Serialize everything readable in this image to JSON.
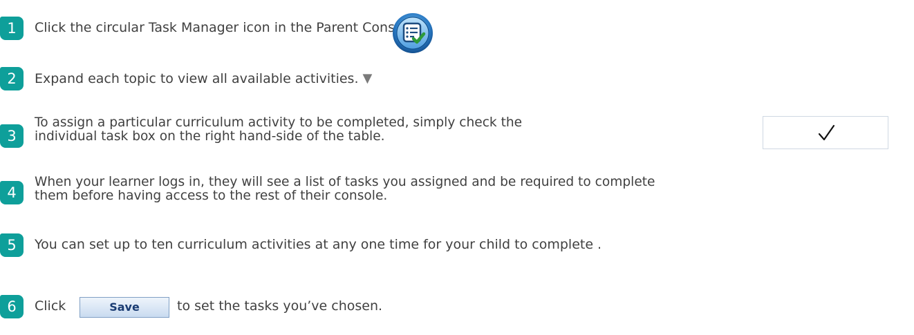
{
  "colors": {
    "badge": "#0e9f9a",
    "text": "#404040",
    "arrow": "#7a7a7a"
  },
  "steps": [
    {
      "number": "1",
      "text": "Click the circular Task Manager icon in the Parent Console."
    },
    {
      "number": "2",
      "text": "Expand each topic to view all available activities.",
      "arrow": "▼"
    },
    {
      "number": "3",
      "lines": [
        "To assign a particular curriculum activity to be completed, simply check the",
        "individual task box on the right hand-side of the table."
      ],
      "checkmark": "✓"
    },
    {
      "number": "4",
      "lines": [
        "When your learner logs in, they will see a list of tasks you assigned and be required to complete",
        "them before having access to the rest of their console."
      ]
    },
    {
      "number": "5",
      "text": "You can set up to ten curriculum activities at any one time for your child to complete ."
    },
    {
      "number": "6",
      "text_before": "Click",
      "button_label": "Save",
      "text_after": "to set the tasks you’ve chosen."
    }
  ]
}
